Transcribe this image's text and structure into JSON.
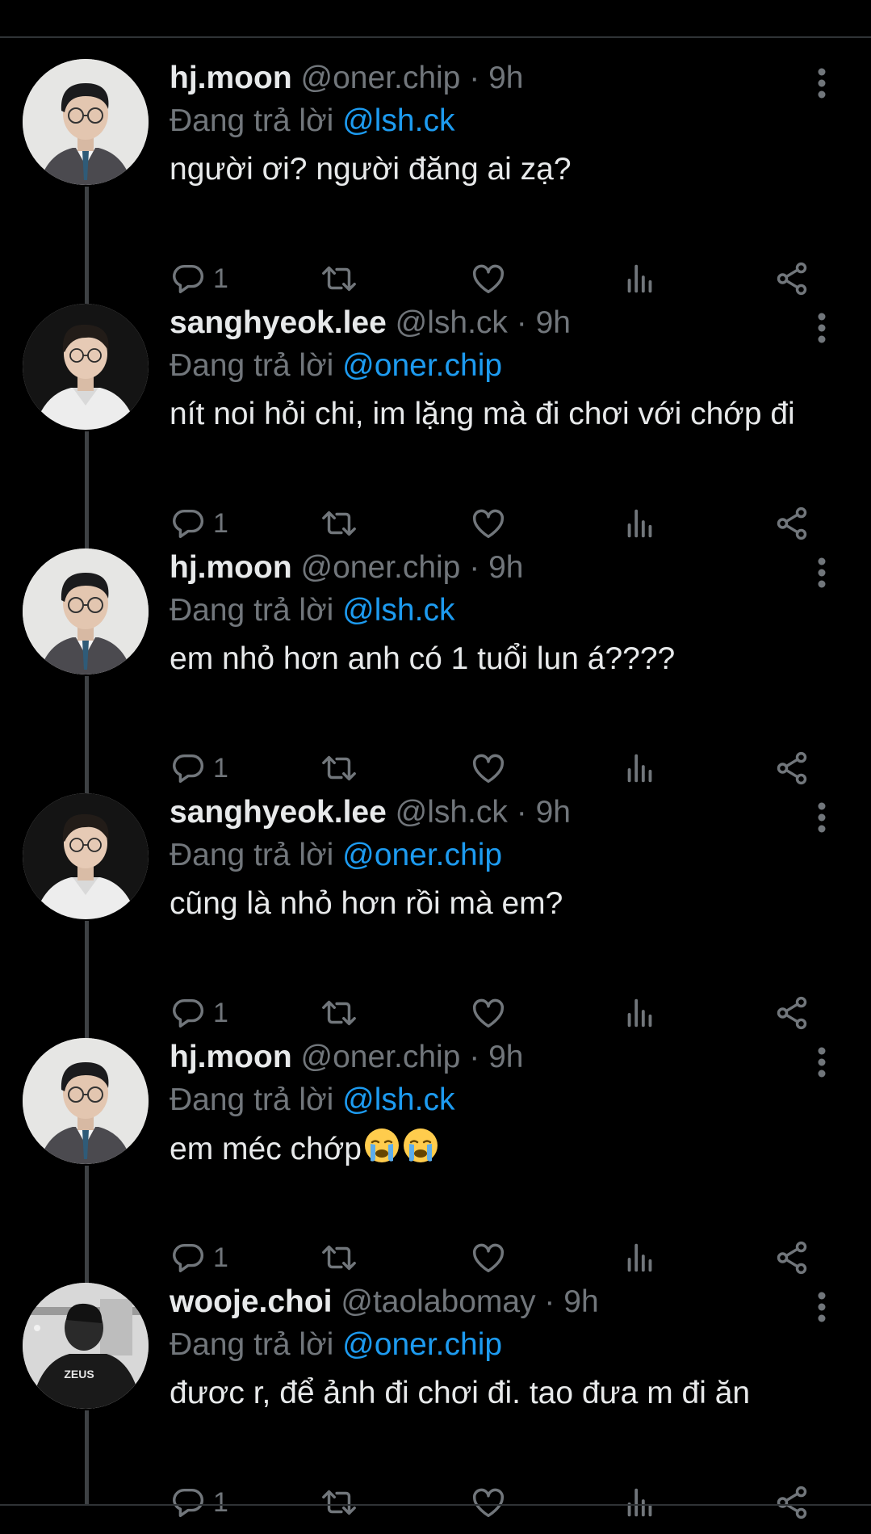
{
  "colors": {
    "background": "#000000",
    "text": "#e7e9ea",
    "muted": "#71767b",
    "mention": "#1d9bf0",
    "divider": "#2f3336",
    "thread_line": "#3e4144"
  },
  "tweets": [
    {
      "name": "hj.moon",
      "handle": "@oner.chip",
      "dot": "·",
      "time": "9h",
      "replying_prefix": "Đang trả lời",
      "replying_to": "@lsh.ck",
      "text": "người ơi? người đăng ai zạ?",
      "reply_count": "1",
      "avatar": "avatar-glasses-suit"
    },
    {
      "name": "sanghyeok.lee",
      "handle": "@lsh.ck",
      "dot": "·",
      "time": "9h",
      "replying_prefix": "Đang trả lời",
      "replying_to": "@oner.chip",
      "text": "nít noi hỏi chi, im lặng mà đi chơi với chớp đi",
      "reply_count": "1",
      "avatar": "avatar-white-shirt"
    },
    {
      "name": "hj.moon",
      "handle": "@oner.chip",
      "dot": "·",
      "time": "9h",
      "replying_prefix": "Đang trả lời",
      "replying_to": "@lsh.ck",
      "text": "em nhỏ hơn anh có 1 tuổi lun á????",
      "reply_count": "1",
      "avatar": "avatar-glasses-suit"
    },
    {
      "name": "sanghyeok.lee",
      "handle": "@lsh.ck",
      "dot": "·",
      "time": "9h",
      "replying_prefix": "Đang trả lời",
      "replying_to": "@oner.chip",
      "text": "cũng là nhỏ hơn rồi mà em?",
      "reply_count": "1",
      "avatar": "avatar-white-shirt"
    },
    {
      "name": "hj.moon",
      "handle": "@oner.chip",
      "dot": "·",
      "time": "9h",
      "replying_prefix": "Đang trả lời",
      "replying_to": "@lsh.ck",
      "text": "em méc chớp",
      "emoji_count": 2,
      "emoji": "loudly-crying-face",
      "reply_count": "1",
      "avatar": "avatar-glasses-suit"
    },
    {
      "name": "wooje.choi",
      "handle": "@taolabomay",
      "dot": "·",
      "time": "9h",
      "replying_prefix": "Đang trả lời",
      "replying_to": "@oner.chip",
      "text": "đươc r, để ảnh đi chơi đi. tao đưa m đi ăn",
      "reply_count": "1",
      "avatar": "avatar-zeus-jersey",
      "avatar_text": "ZEUS"
    }
  ],
  "icons": {
    "more": "more-vertical-icon",
    "reply": "reply-icon",
    "retweet": "retweet-icon",
    "like": "heart-icon",
    "views": "views-icon",
    "share": "share-icon"
  }
}
